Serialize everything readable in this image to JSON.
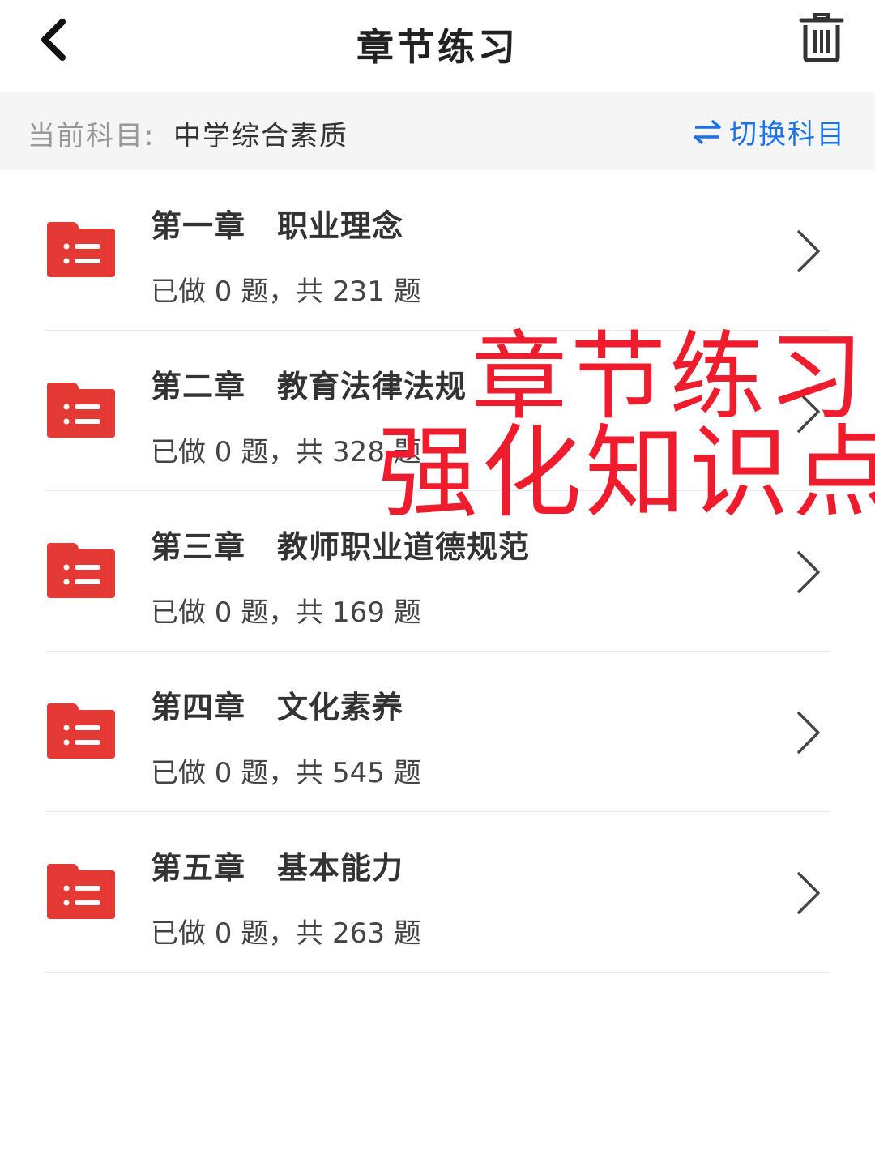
{
  "header": {
    "title": "章节练习",
    "back_icon": "chevron-left-icon",
    "trash_icon": "trash-icon"
  },
  "subject": {
    "label": "当前科目:",
    "value": "中学综合素质",
    "switch_label": "切换科目",
    "switch_icon": "swap-icon"
  },
  "chapters": [
    {
      "title": "第一章　职业理念",
      "progress": "已做 0 题，共 231 题"
    },
    {
      "title": "第二章　教育法律法规",
      "progress": "已做 0 题，共 328 题"
    },
    {
      "title": "第三章　教师职业道德规范",
      "progress": "已做 0 题，共 169 题"
    },
    {
      "title": "第四章　文化素养",
      "progress": "已做 0 题，共 545 题"
    },
    {
      "title": "第五章　基本能力",
      "progress": "已做 0 题，共 263 题"
    }
  ],
  "overlay": {
    "line1": "章节练习",
    "line2": "强化知识点"
  },
  "colors": {
    "accent_red": "#e53935",
    "overlay_red": "#ee1c2c",
    "link_blue": "#1a73e8"
  }
}
